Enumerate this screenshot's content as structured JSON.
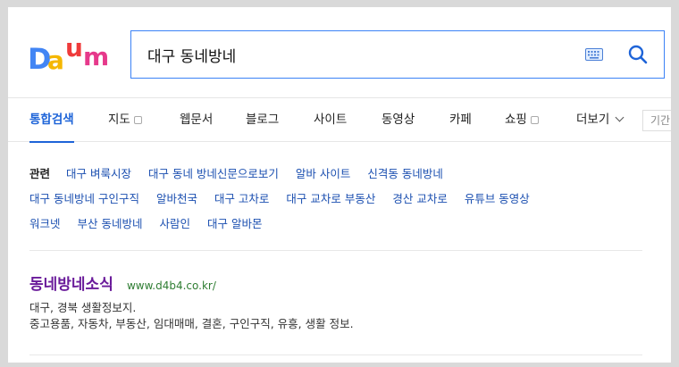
{
  "logo": {
    "letters": [
      "D",
      "a",
      "u",
      "m"
    ],
    "colors": [
      "#4285f4",
      "#f5b700",
      "#ef3b3b",
      "#e6398b"
    ]
  },
  "search": {
    "query": "대구 동네방네",
    "keyboard_icon": "keyboard-icon",
    "search_icon": "magnifier-icon",
    "accent": "#3b82f6"
  },
  "nav": {
    "tabs": [
      {
        "label": "통합검색",
        "active": true
      },
      {
        "label": "지도",
        "has_badge": true
      },
      {
        "label": "웹문서"
      },
      {
        "label": "블로그"
      },
      {
        "label": "사이트"
      },
      {
        "label": "동영상"
      },
      {
        "label": "카페"
      },
      {
        "label": "쇼핑",
        "has_badge": true
      },
      {
        "label": "더보기",
        "has_chevron": true
      }
    ],
    "period_label": "기간"
  },
  "related": {
    "title": "관련",
    "rows": [
      [
        "대구 벼룩시장",
        "대구 동네 방네신문으로보기",
        "알바 사이트",
        "신격동 동네방네"
      ],
      [
        "대구 동네방네 구인구직",
        "알바천국",
        "대구 고차로",
        "대구 교차로 부동산",
        "경산 교차로",
        "유튜브 동영상"
      ],
      [
        "워크넷",
        "부산 동네방네",
        "사람인",
        "대구 알바몬"
      ]
    ],
    "link_color": "#1b4fb0"
  },
  "result": {
    "title": "동네방네소식",
    "url": "www.d4b4.co.kr/",
    "desc_line1": "대구, 경북 생활정보지.",
    "desc_line2": "중고용품, 자동차, 부동산, 임대매매, 결혼, 구인구직, 유흥, 생활 정보."
  }
}
